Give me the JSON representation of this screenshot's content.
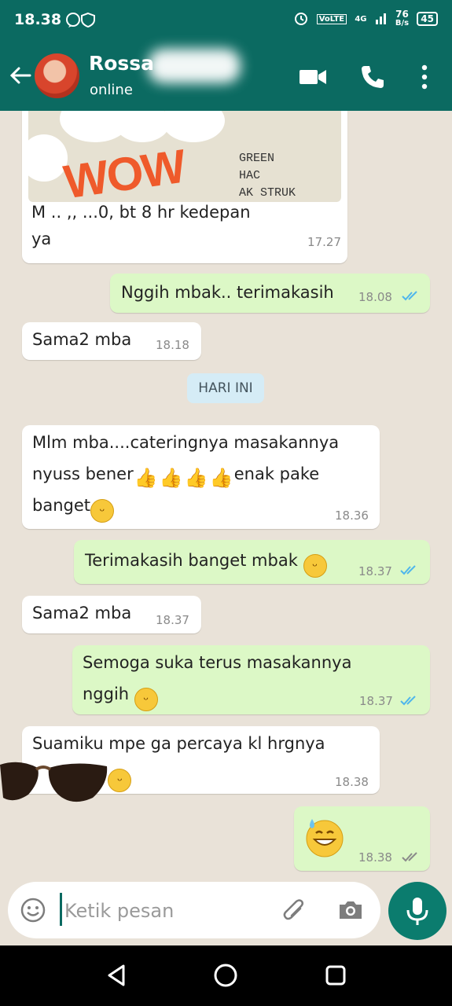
{
  "status_bar": {
    "time": "18.38",
    "network_label": "VoLTE",
    "signal_label": "4G",
    "speed_value": "76",
    "speed_unit": "B/s",
    "battery": "45"
  },
  "header": {
    "contact_name": "Rossa",
    "contact_status": "online",
    "icons": [
      "back-arrow-icon",
      "video-call-icon",
      "phone-icon",
      "more-vert-icon"
    ]
  },
  "chat": {
    "image_message": {
      "overlay_text": "WOW",
      "stamp_lines": [
        "GREEN",
        "HAC",
        "AK STRUK"
      ],
      "caption_line1": "M        .. ,, ...0, bt 8 hr kedepan",
      "caption_line2": "ya",
      "time": "17.27"
    },
    "messages": [
      {
        "direction": "out",
        "text": "Nggih mbak.. terimakasih",
        "time": "18.08",
        "status": "read"
      },
      {
        "direction": "in",
        "text": "Sama2 mba",
        "time": "18.18"
      },
      {
        "direction": "in",
        "lines": [
          "Mlm mba....cateringnya masakannya",
          "nyuss bener",
          "enak pake",
          "banget"
        ],
        "time": "18.36"
      },
      {
        "direction": "out",
        "text": "Terimakasih banget mbak",
        "time": "18.37",
        "status": "read"
      },
      {
        "direction": "in",
        "text": "Sama2 mba",
        "time": "18.37"
      },
      {
        "direction": "out",
        "lines": [
          "Semoga suka terus masakannya",
          "nggih"
        ],
        "time": "18.37",
        "status": "read"
      },
      {
        "direction": "in",
        "lines": [
          "Suamiku mpe ga percaya kl hrgnya",
          "m"
        ],
        "time": "18.38"
      },
      {
        "direction": "out",
        "text": "",
        "time": "18.38",
        "status": "delivered"
      }
    ],
    "date_chip": "HARI INI"
  },
  "composer": {
    "placeholder": "Ketik pesan",
    "icons": [
      "emoji-icon",
      "attach-icon",
      "camera-icon",
      "mic-icon"
    ]
  },
  "colors": {
    "header": "#0b6a61",
    "outgoing_bubble": "#dcf8c6",
    "incoming_bubble": "#ffffff",
    "read_tick": "#4fb6ec",
    "date_chip": "#d5ecf6"
  }
}
